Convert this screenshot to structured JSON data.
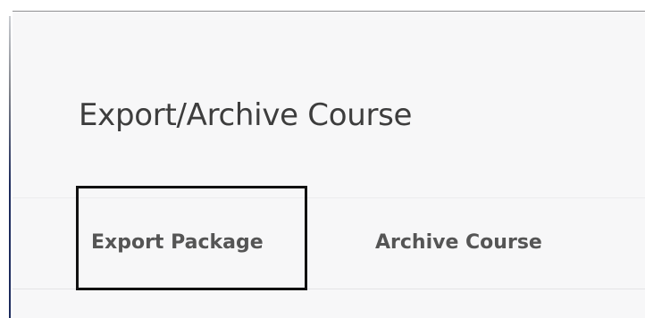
{
  "page": {
    "title": "Export/Archive Course"
  },
  "tabs": [
    {
      "label": "Export Package",
      "highlighted": true
    },
    {
      "label": "Archive Course",
      "highlighted": false
    }
  ],
  "colors": {
    "panel_background": "#f7f7f8",
    "title_text": "#3d3d3d",
    "tab_text": "#555555",
    "highlight_border": "#111111",
    "sidebar_accent": "#1c2a5c"
  }
}
